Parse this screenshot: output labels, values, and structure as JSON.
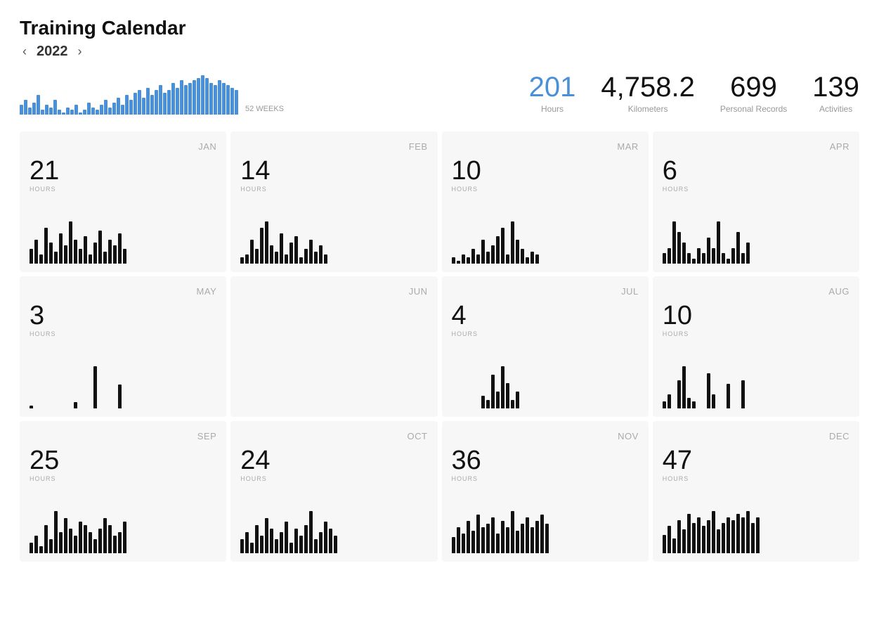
{
  "page": {
    "title": "Training Calendar",
    "year": "2022",
    "prev_year_label": "‹",
    "next_year_label": "›",
    "weeks_label": "52 WEEKS"
  },
  "stats": [
    {
      "value": "201",
      "label": "Hours",
      "blue": true
    },
    {
      "value": "4,758.2",
      "label": "Kilometers",
      "blue": false
    },
    {
      "value": "699",
      "label": "Personal Records",
      "blue": false
    },
    {
      "value": "139",
      "label": "Activities",
      "blue": false
    }
  ],
  "sparkline_bars": [
    4,
    6,
    3,
    5,
    8,
    2,
    4,
    3,
    6,
    2,
    1,
    3,
    2,
    4,
    1,
    2,
    5,
    3,
    2,
    4,
    6,
    3,
    5,
    7,
    4,
    8,
    6,
    9,
    10,
    7,
    11,
    8,
    10,
    12,
    9,
    10,
    13,
    11,
    14,
    12,
    13,
    14,
    15,
    16,
    15,
    13,
    12,
    14,
    13,
    12,
    11,
    10
  ],
  "months": [
    {
      "name": "JAN",
      "hours": 21,
      "bars": [
        5,
        8,
        3,
        12,
        7,
        4,
        10,
        6,
        14,
        8,
        5,
        9,
        3,
        7,
        11,
        4,
        8,
        6,
        10,
        5
      ]
    },
    {
      "name": "FEB",
      "hours": 14,
      "bars": [
        2,
        3,
        8,
        5,
        12,
        14,
        6,
        4,
        10,
        3,
        7,
        9,
        2,
        5,
        8,
        4,
        6,
        3
      ]
    },
    {
      "name": "MAR",
      "hours": 10,
      "bars": [
        2,
        1,
        3,
        2,
        5,
        3,
        8,
        4,
        6,
        9,
        12,
        3,
        14,
        8,
        5,
        2,
        4,
        3
      ]
    },
    {
      "name": "APR",
      "hours": 6,
      "bars": [
        2,
        3,
        8,
        6,
        4,
        2,
        1,
        3,
        2,
        5,
        3,
        8,
        2,
        1,
        3,
        6,
        2,
        4
      ]
    },
    {
      "name": "MAY",
      "hours": 3,
      "bars": [
        1,
        0,
        0,
        0,
        0,
        0,
        0,
        0,
        0,
        2,
        0,
        0,
        0,
        14,
        0,
        0,
        0,
        0,
        8,
        0
      ]
    },
    {
      "name": "JUN",
      "hours": null,
      "bars": []
    },
    {
      "name": "JUL",
      "hours": 4,
      "bars": [
        0,
        0,
        0,
        0,
        0,
        0,
        3,
        2,
        8,
        4,
        10,
        6,
        2,
        4,
        0,
        0,
        0,
        0
      ]
    },
    {
      "name": "AUG",
      "hours": 10,
      "bars": [
        2,
        4,
        0,
        8,
        12,
        3,
        2,
        0,
        0,
        10,
        4,
        0,
        0,
        7,
        0,
        0,
        8,
        0
      ]
    },
    {
      "name": "SEP",
      "hours": 25,
      "bars": [
        3,
        5,
        2,
        8,
        4,
        12,
        6,
        10,
        7,
        5,
        9,
        8,
        6,
        4,
        7,
        10,
        8,
        5,
        6,
        9
      ]
    },
    {
      "name": "OCT",
      "hours": 24,
      "bars": [
        4,
        6,
        3,
        8,
        5,
        10,
        7,
        4,
        6,
        9,
        3,
        7,
        5,
        8,
        12,
        4,
        6,
        9,
        7,
        5
      ]
    },
    {
      "name": "NOV",
      "hours": 36,
      "bars": [
        5,
        8,
        6,
        10,
        7,
        12,
        8,
        9,
        11,
        6,
        10,
        8,
        13,
        7,
        9,
        11,
        8,
        10,
        12,
        9
      ]
    },
    {
      "name": "DEC",
      "hours": 47,
      "bars": [
        6,
        9,
        5,
        11,
        8,
        13,
        10,
        12,
        9,
        11,
        14,
        8,
        10,
        12,
        11,
        13,
        12,
        14,
        10,
        12
      ]
    }
  ]
}
